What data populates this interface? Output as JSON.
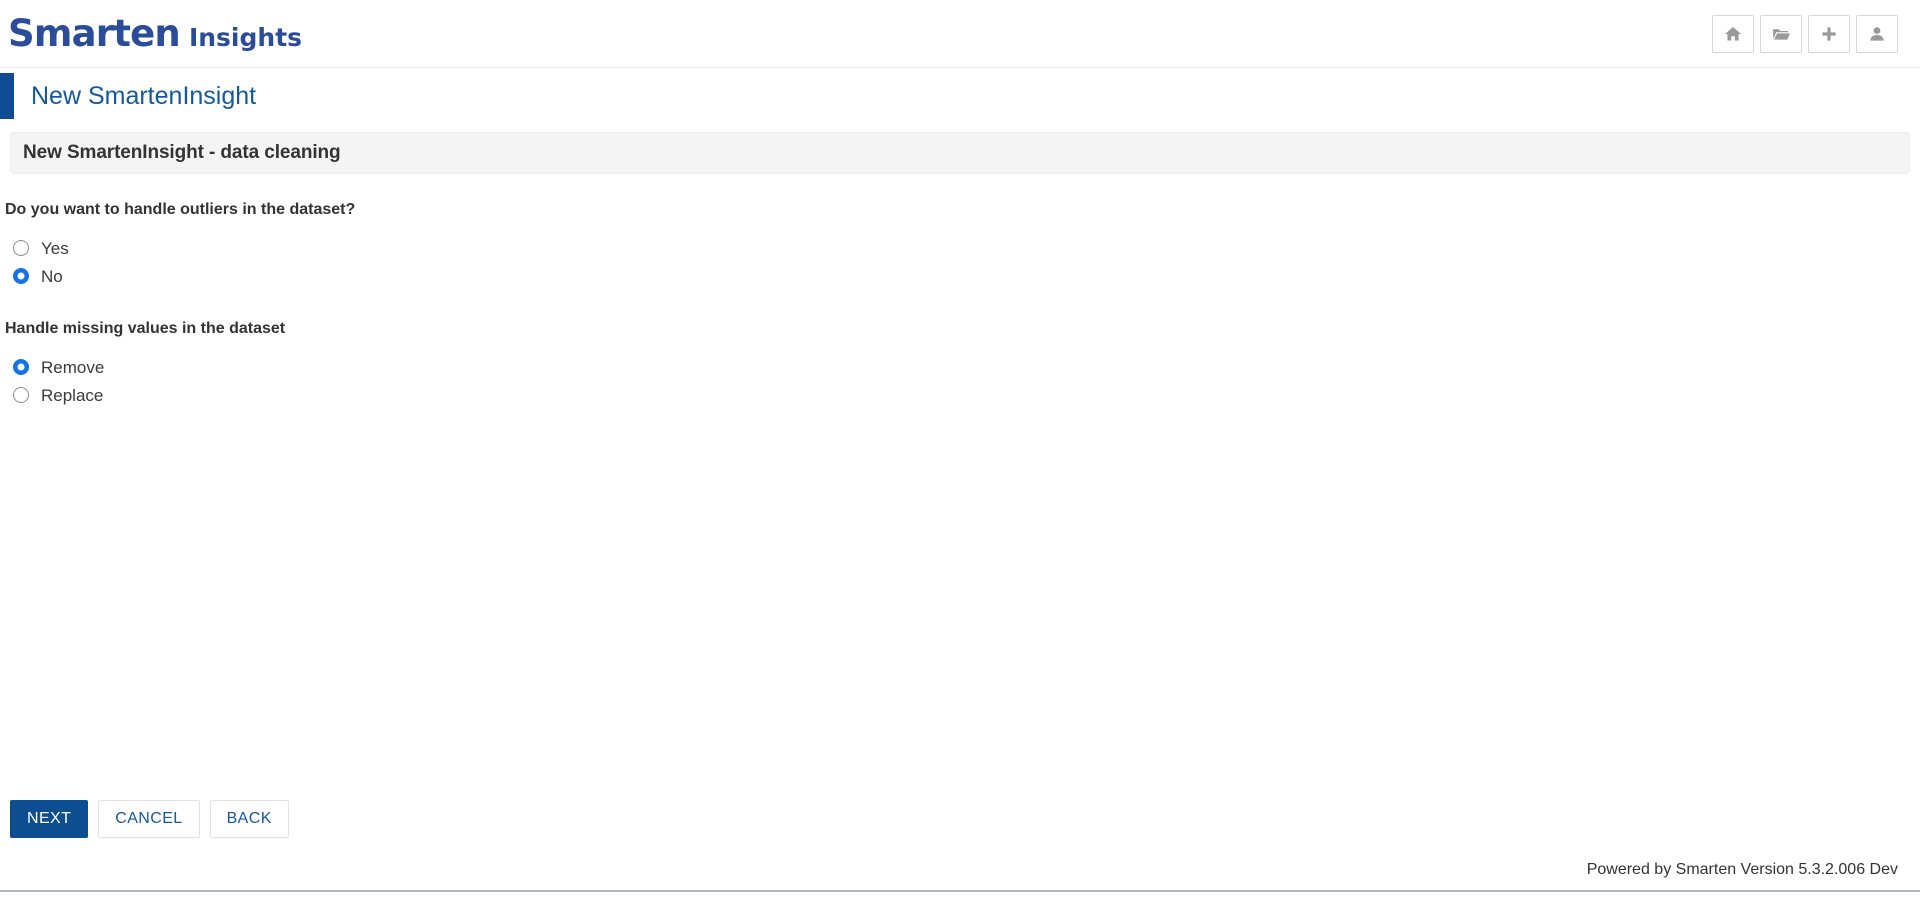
{
  "app": {
    "brand_main": "Smarten",
    "brand_sub": "Insights"
  },
  "topbar": {
    "icons": [
      {
        "name": "home-icon",
        "label": "Home"
      },
      {
        "name": "folder-open-icon",
        "label": "Open"
      },
      {
        "name": "plus-icon",
        "label": "New"
      },
      {
        "name": "user-icon",
        "label": "User"
      }
    ]
  },
  "page": {
    "title": "New SmartenInsight",
    "accent_color": "#0f4c93",
    "title_color": "#14589e"
  },
  "section": {
    "header_title": "New SmartenInsight - data cleaning"
  },
  "form": {
    "outliers": {
      "label": "Do you want to handle outliers in the dataset?",
      "options": [
        {
          "label": "Yes",
          "checked": false
        },
        {
          "label": "No",
          "checked": true
        }
      ]
    },
    "missing_values": {
      "label": "Handle missing values in the dataset",
      "options": [
        {
          "label": "Remove",
          "checked": true
        },
        {
          "label": "Replace",
          "checked": false
        }
      ]
    }
  },
  "actions": {
    "next_label": "NEXT",
    "cancel_label": "CANCEL",
    "back_label": "BACK",
    "primary_color": "#0d4e91"
  },
  "footer": {
    "text": "Powered by Smarten Version 5.3.2.006 Dev"
  }
}
